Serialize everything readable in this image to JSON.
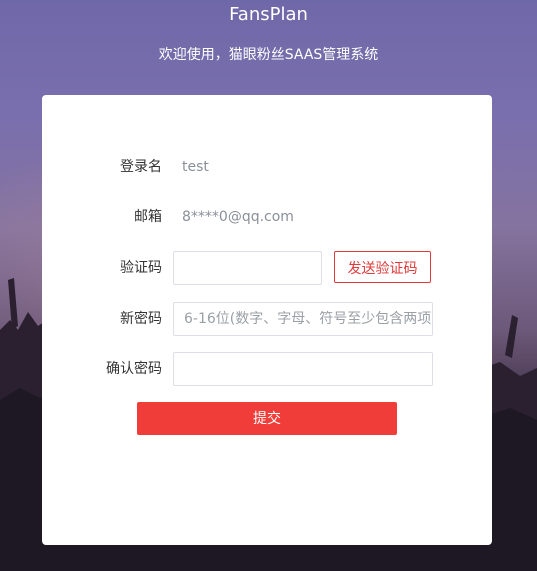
{
  "header": {
    "app_title": "FansPlan",
    "subtitle": "欢迎使用，猫眼粉丝SAAS管理系统"
  },
  "form": {
    "login_name": {
      "label": "登录名",
      "value": "test"
    },
    "email": {
      "label": "邮箱",
      "value": "8****0@qq.com"
    },
    "verification_code": {
      "label": "验证码",
      "value": "",
      "placeholder": "",
      "send_button_label": "发送验证码"
    },
    "new_password": {
      "label": "新密码",
      "value": "",
      "placeholder": "6-16位(数字、字母、符号至少包含两项)"
    },
    "confirm_password": {
      "label": "确认密码",
      "value": "",
      "placeholder": ""
    },
    "submit_label": "提交"
  },
  "colors": {
    "accent": "#f13d3a",
    "accent_border": "#e03a3a",
    "background_top": "#6f68a8",
    "background_bottom": "#15111d"
  }
}
